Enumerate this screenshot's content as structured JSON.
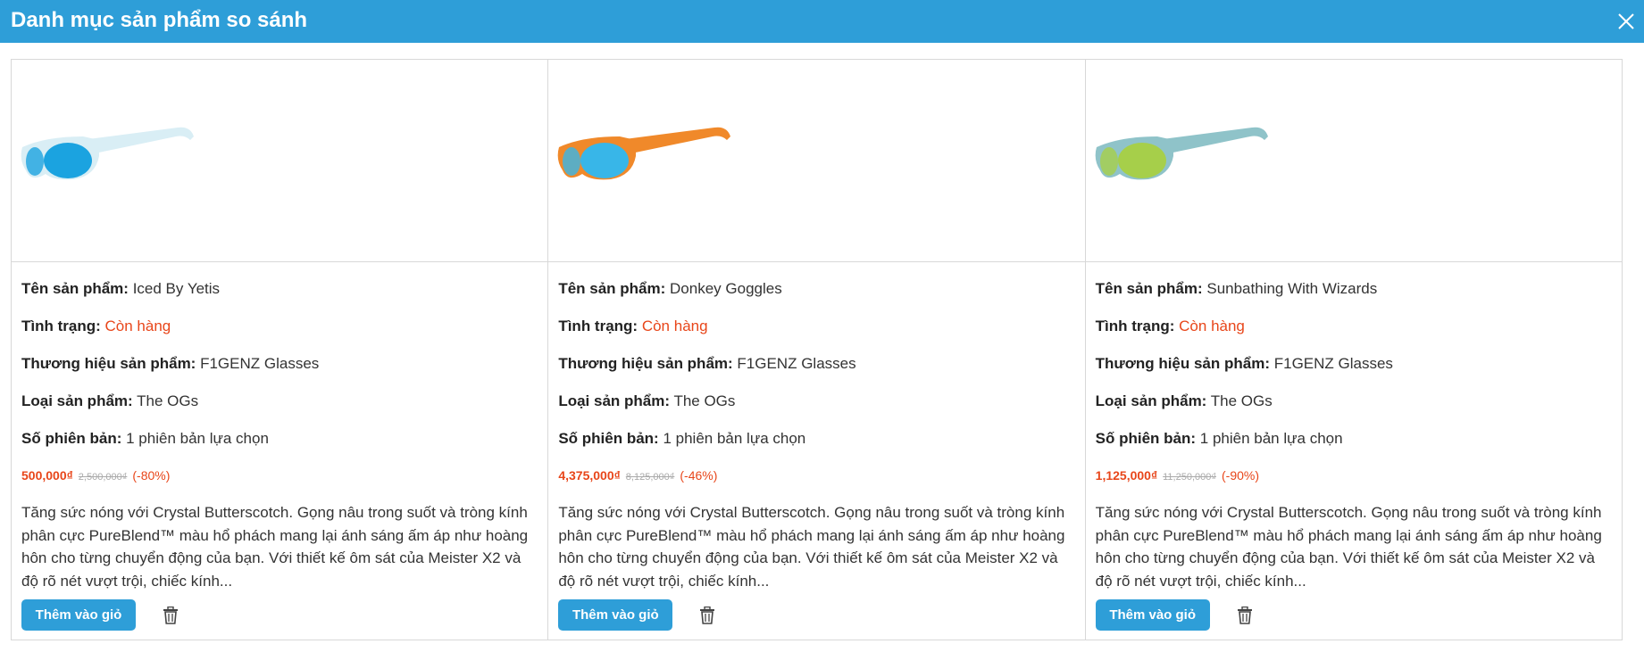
{
  "header": {
    "title": "Danh mục sản phẩm so sánh",
    "close_icon": "close-icon"
  },
  "labels": {
    "name": "Tên sản phẩm:",
    "status": "Tình trạng:",
    "brand": "Thương hiệu sản phẩm:",
    "type": "Loại sản phẩm:",
    "variants": "Số phiên bản:",
    "add_to_cart": "Thêm vào giỏ"
  },
  "colors": {
    "accent": "#2e9ed8",
    "sale": "#e8461a"
  },
  "products": [
    {
      "name": "Iced By Yetis",
      "status": "Còn hàng",
      "brand": "F1GENZ Glasses",
      "type": "The OGs",
      "variants": "1 phiên bản lựa chọn",
      "price": "500,000₫",
      "old_price": "2,500,000₫",
      "discount": "(-80%)",
      "description": "Tăng sức nóng với Crystal Butterscotch. Gọng nâu trong suốt và tròng kính phân cực PureBlend™ màu hổ phách mang lại ánh sáng ấm áp như hoàng hôn cho từng chuyển động của bạn. Với thiết kế ôm sát của Meister X2 và độ rõ nét vượt trội, chiếc kính...",
      "frame_color": "#d9eef5",
      "lens_color": "#1ba3e0"
    },
    {
      "name": "Donkey Goggles",
      "status": "Còn hàng",
      "brand": "F1GENZ Glasses",
      "type": "The OGs",
      "variants": "1 phiên bản lựa chọn",
      "price": "4,375,000₫",
      "old_price": "8,125,000₫",
      "discount": "(-46%)",
      "description": "Tăng sức nóng với Crystal Butterscotch. Gọng nâu trong suốt và tròng kính phân cực PureBlend™ màu hổ phách mang lại ánh sáng ấm áp như hoàng hôn cho từng chuyển động của bạn. Với thiết kế ôm sát của Meister X2 và độ rõ nét vượt trội, chiếc kính...",
      "frame_color": "#f0892a",
      "lens_color": "#38b6e8"
    },
    {
      "name": "Sunbathing With Wizards",
      "status": "Còn hàng",
      "brand": "F1GENZ Glasses",
      "type": "The OGs",
      "variants": "1 phiên bản lựa chọn",
      "price": "1,125,000₫",
      "old_price": "11,250,000₫",
      "discount": "(-90%)",
      "description": "Tăng sức nóng với Crystal Butterscotch. Gọng nâu trong suốt và tròng kính phân cực PureBlend™ màu hổ phách mang lại ánh sáng ấm áp như hoàng hôn cho từng chuyển động của bạn. Với thiết kế ôm sát của Meister X2 và độ rõ nét vượt trội, chiếc kính...",
      "frame_color": "#8fc3c9",
      "lens_color": "#a6cf4a"
    }
  ]
}
